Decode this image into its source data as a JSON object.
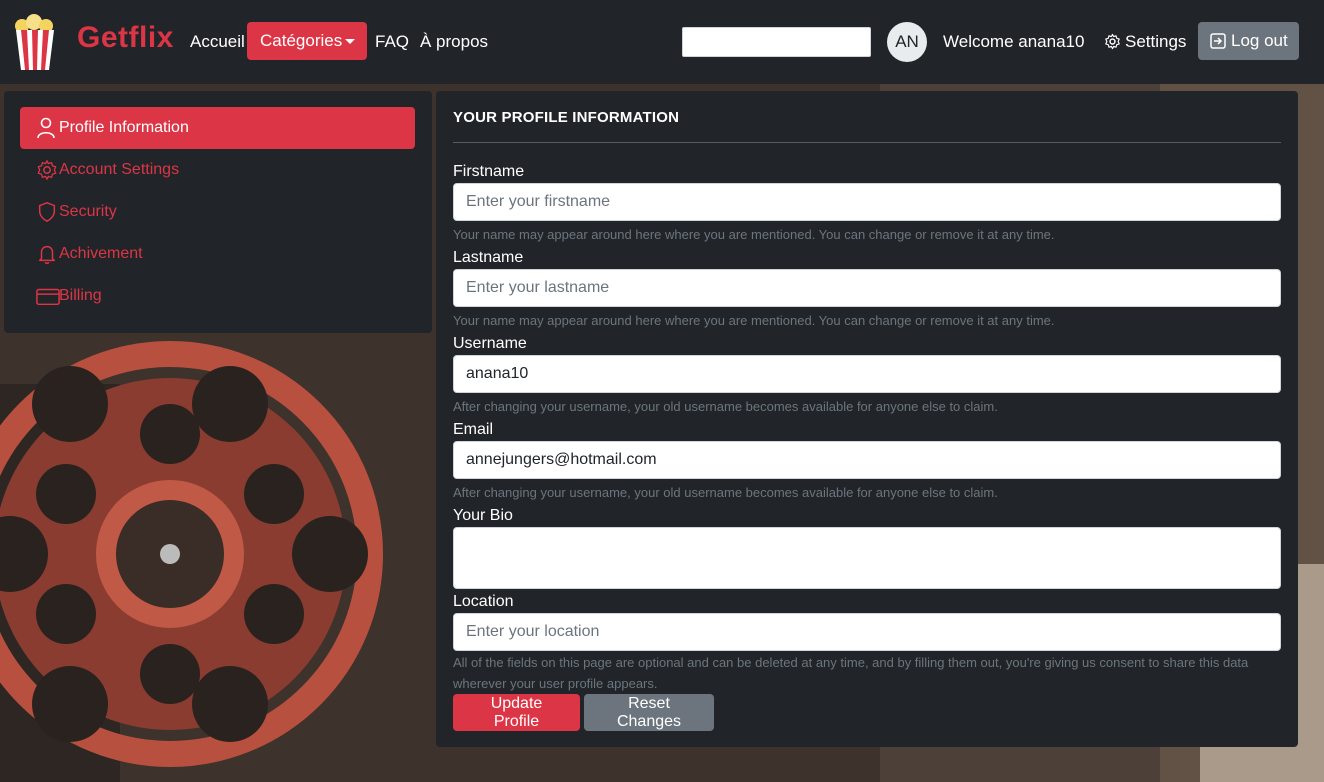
{
  "brand": {
    "name": "Getflix",
    "logo_icon": "popcorn-logo"
  },
  "nav": {
    "home": "Accueil",
    "categories": "Catégories",
    "faq": "FAQ",
    "about": "À propos",
    "search_value": "",
    "avatar_initials": "AN",
    "welcome": "Welcome anana10",
    "settings": "Settings",
    "logout": "Log out"
  },
  "sidebar": {
    "items": [
      {
        "label": "Profile Information",
        "icon": "person-icon",
        "active": true
      },
      {
        "label": "Account Settings",
        "icon": "gear-icon",
        "active": false
      },
      {
        "label": "Security",
        "icon": "shield-icon",
        "active": false
      },
      {
        "label": "Achivement",
        "icon": "bell-icon",
        "active": false
      },
      {
        "label": "Billing",
        "icon": "credit-card-icon",
        "active": false
      }
    ]
  },
  "profile": {
    "title": "YOUR PROFILE INFORMATION",
    "firstname": {
      "label": "Firstname",
      "value": "",
      "placeholder": "Enter your firstname",
      "help": "Your name may appear around here where you are mentioned. You can change or remove it at any time."
    },
    "lastname": {
      "label": "Lastname",
      "value": "",
      "placeholder": "Enter your lastname",
      "help": "Your name may appear around here where you are mentioned. You can change or remove it at any time."
    },
    "username": {
      "label": "Username",
      "value": "anana10",
      "help": "After changing your username, your old username becomes available for anyone else to claim."
    },
    "email": {
      "label": "Email",
      "value": "annejungers@hotmail.com",
      "help": "After changing your username, your old username becomes available for anyone else to claim."
    },
    "bio": {
      "label": "Your Bio",
      "value": ""
    },
    "location": {
      "label": "Location",
      "value": "",
      "placeholder": "Enter your location",
      "help": "All of the fields on this page are optional and can be deleted at any time, and by filling them out, you're giving us consent to share this data wherever your user profile appears."
    },
    "update_button": "Update Profile",
    "reset_button": "Reset Changes"
  },
  "colors": {
    "accent": "#dc3545",
    "dark": "#212529",
    "secondary": "#6c757d"
  }
}
